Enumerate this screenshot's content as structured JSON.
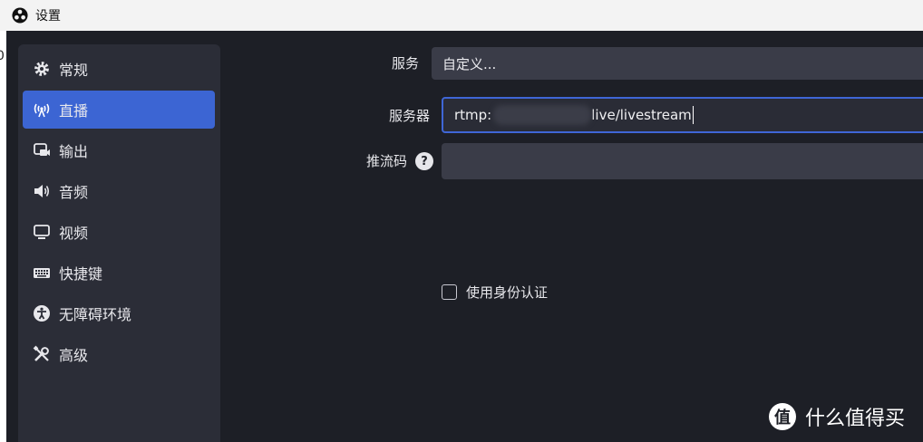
{
  "window": {
    "title": "设置",
    "left_edge_char": "0"
  },
  "sidebar": {
    "items": [
      {
        "label": "常规",
        "icon": "gear-icon"
      },
      {
        "label": "直播",
        "icon": "antenna-icon",
        "active": true
      },
      {
        "label": "输出",
        "icon": "output-icon"
      },
      {
        "label": "音频",
        "icon": "speaker-icon"
      },
      {
        "label": "视频",
        "icon": "monitor-icon"
      },
      {
        "label": "快捷键",
        "icon": "keyboard-icon"
      },
      {
        "label": "无障碍环境",
        "icon": "accessibility-icon"
      },
      {
        "label": "高级",
        "icon": "tools-icon"
      }
    ]
  },
  "stream": {
    "service_label": "服务",
    "service_value": "自定义...",
    "server_label": "服务器",
    "server_prefix": "rtmp:",
    "server_suffix": "live/livestream",
    "key_label": "推流码",
    "key_help": "?",
    "key_value": "",
    "auth_label": "使用身份认证",
    "auth_checked": false
  },
  "watermark": {
    "symbol": "值",
    "text": "什么值得买"
  },
  "colors": {
    "accent": "#3c65d3",
    "background": "#1d1f26",
    "sidebar": "#2b2d37",
    "field": "#3a3c48"
  }
}
